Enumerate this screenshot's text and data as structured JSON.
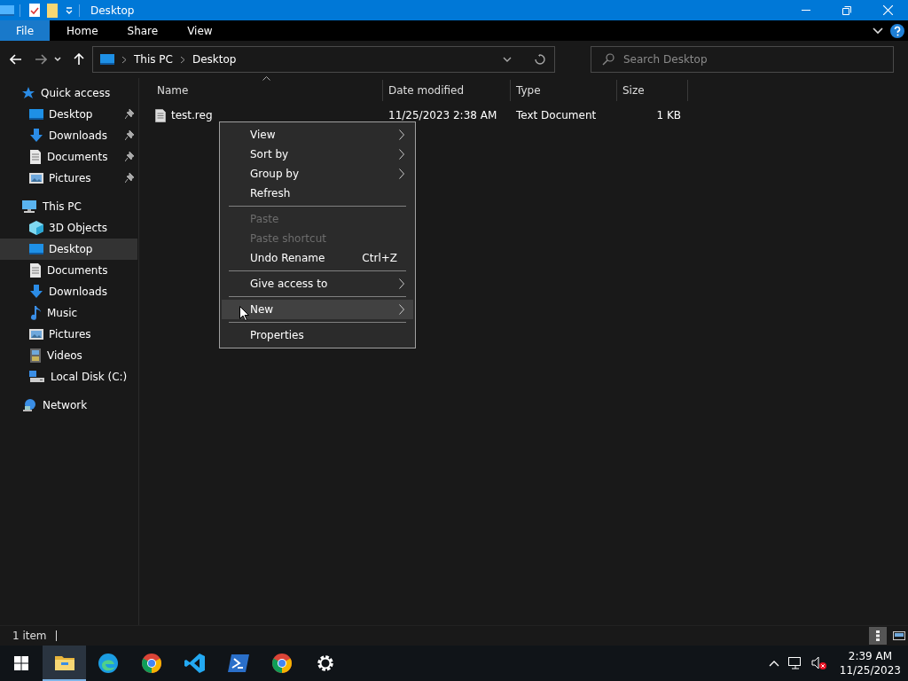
{
  "window": {
    "title": "Desktop"
  },
  "ribbon_tabs": [
    {
      "label": "File",
      "selected": true
    },
    {
      "label": "Home",
      "selected": false
    },
    {
      "label": "Share",
      "selected": false
    },
    {
      "label": "View",
      "selected": false
    }
  ],
  "address": {
    "path": [
      "This PC",
      "Desktop"
    ]
  },
  "search": {
    "placeholder": "Search Desktop"
  },
  "navigation": [
    {
      "label": "Quick access",
      "selected": false,
      "children": [
        {
          "label": "Desktop",
          "pinned": true,
          "selected": false
        },
        {
          "label": "Downloads",
          "pinned": true,
          "selected": false
        },
        {
          "label": "Documents",
          "pinned": true,
          "selected": false
        },
        {
          "label": "Pictures",
          "pinned": true,
          "selected": false
        }
      ]
    },
    {
      "label": "This PC",
      "selected": false,
      "children": [
        {
          "label": "3D Objects",
          "pinned": false,
          "selected": false
        },
        {
          "label": "Desktop",
          "pinned": false,
          "selected": true
        },
        {
          "label": "Documents",
          "pinned": false,
          "selected": false
        },
        {
          "label": "Downloads",
          "pinned": false,
          "selected": false
        },
        {
          "label": "Music",
          "pinned": false,
          "selected": false
        },
        {
          "label": "Pictures",
          "pinned": false,
          "selected": false
        },
        {
          "label": "Videos",
          "pinned": false,
          "selected": false
        },
        {
          "label": "Local Disk (C:)",
          "pinned": false,
          "selected": false
        }
      ]
    },
    {
      "label": "Network",
      "selected": false
    }
  ],
  "table": {
    "columns": [
      "Name",
      "Date modified",
      "Type",
      "Size"
    ],
    "rows": [
      {
        "cells": [
          "test.reg",
          "11/25/2023 2:38 AM",
          "Text Document",
          "1 KB"
        ]
      }
    ]
  },
  "context_menu": {
    "items": [
      {
        "kind": "item",
        "label": "View",
        "submenu": true,
        "disabled": false,
        "selected": false
      },
      {
        "kind": "item",
        "label": "Sort by",
        "submenu": true,
        "disabled": false,
        "selected": false
      },
      {
        "kind": "item",
        "label": "Group by",
        "submenu": true,
        "disabled": false,
        "selected": false
      },
      {
        "kind": "item",
        "label": "Refresh",
        "submenu": false,
        "disabled": false,
        "selected": false
      },
      {
        "kind": "separator"
      },
      {
        "kind": "item",
        "label": "Paste",
        "submenu": false,
        "disabled": true,
        "selected": false
      },
      {
        "kind": "item",
        "label": "Paste shortcut",
        "submenu": false,
        "disabled": true,
        "selected": false
      },
      {
        "kind": "item",
        "label": "Undo Rename",
        "shortcut": "Ctrl+Z",
        "submenu": false,
        "disabled": false,
        "selected": false
      },
      {
        "kind": "separator"
      },
      {
        "kind": "item",
        "label": "Give access to",
        "submenu": true,
        "disabled": false,
        "selected": false
      },
      {
        "kind": "separator"
      },
      {
        "kind": "item",
        "label": "New",
        "submenu": true,
        "disabled": false,
        "selected": true
      },
      {
        "kind": "separator"
      },
      {
        "kind": "item",
        "label": "Properties",
        "submenu": false,
        "disabled": false,
        "selected": false
      }
    ]
  },
  "status_bar": {
    "text": "1 item"
  },
  "taskbar": {
    "apps": [
      {
        "active": true
      },
      {
        "active": false
      },
      {
        "active": false
      },
      {
        "active": false
      },
      {
        "active": false
      },
      {
        "active": false
      },
      {
        "active": false
      }
    ],
    "clock": {
      "time": "2:39 AM",
      "date": "11/25/2023"
    }
  }
}
